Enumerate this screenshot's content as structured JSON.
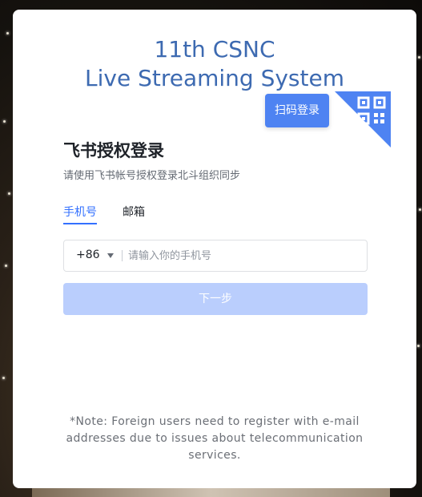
{
  "title": {
    "line1": "11th CSNC",
    "line2": "Live Streaming System"
  },
  "qr_login": {
    "tooltip": "扫码登录",
    "icon": "qr-code-icon"
  },
  "login": {
    "heading": "飞书授权登录",
    "subheading": "请使用飞书帐号授权登录北斗组织同步",
    "tabs": [
      {
        "label": "手机号",
        "active": true
      },
      {
        "label": "邮箱",
        "active": false
      }
    ],
    "country_code": "+86",
    "phone_placeholder": "请输入你的手机号",
    "phone_value": "",
    "next_label": "下一步"
  },
  "note": "*Note: Foreign users need to register with e-mail addresses due to issues about telecommunication services.",
  "colors": {
    "accent": "#3370ff",
    "title": "#3d6ab1",
    "qr_badge": "#4e83f2",
    "button_disabled": "#bacefd"
  }
}
